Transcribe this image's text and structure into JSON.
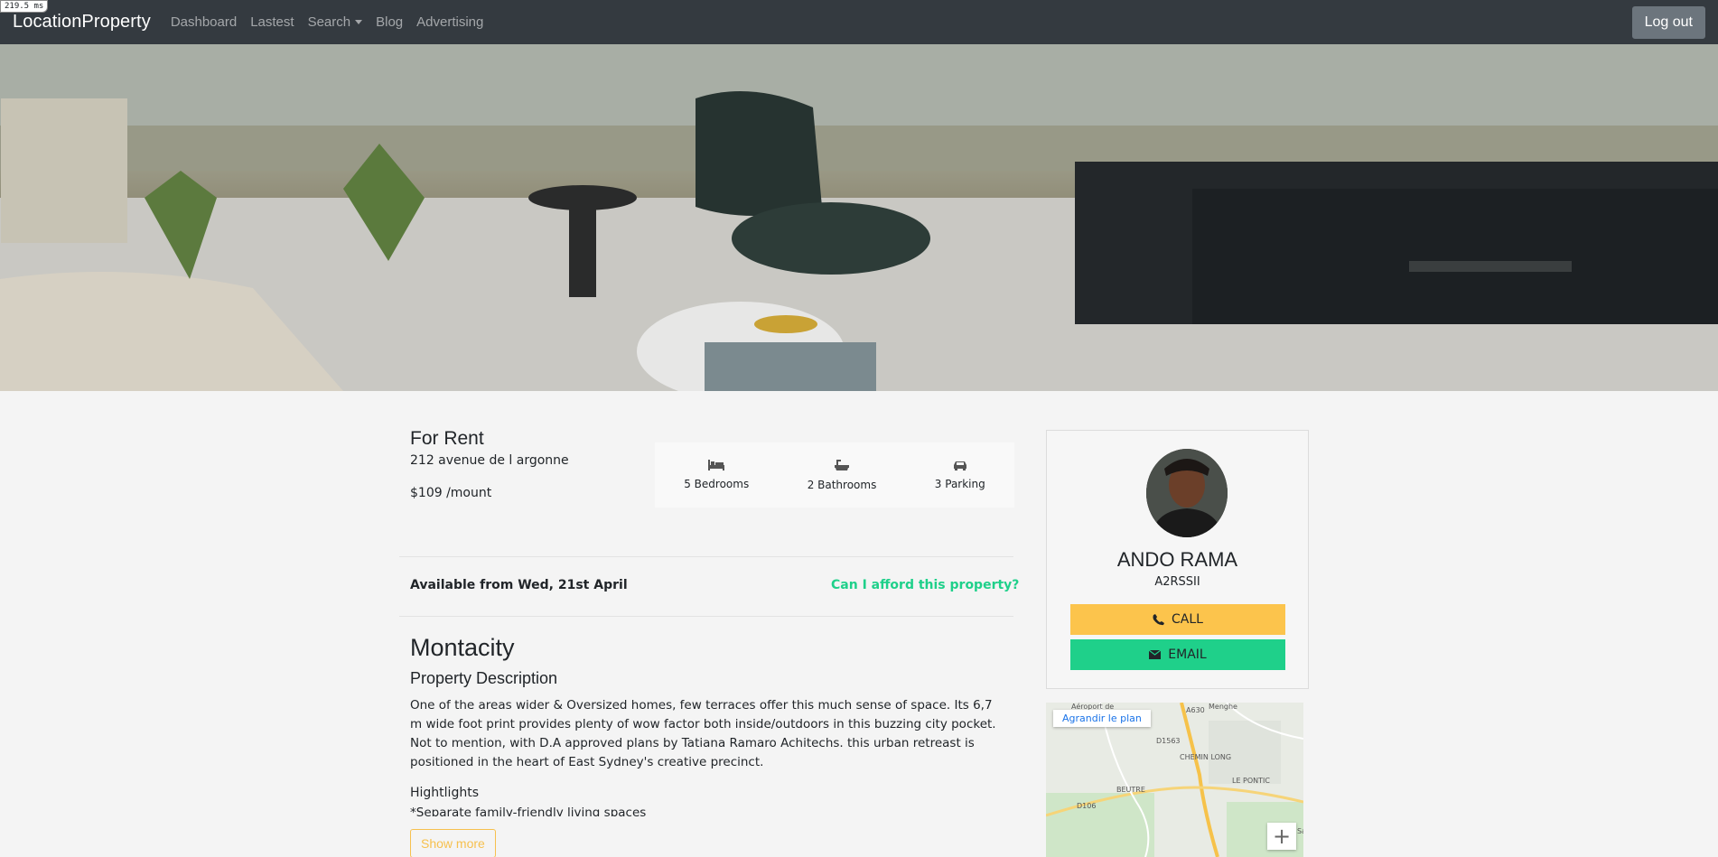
{
  "perf": "219.5 ms",
  "navbar": {
    "brand": "LocationProperty",
    "links": [
      "Dashboard",
      "Lastest",
      "Search",
      "Blog",
      "Advertising"
    ],
    "logout": "Log out"
  },
  "listing": {
    "kind": "For Rent",
    "address": "212 avenue de l argonne",
    "price": "$109 /mount",
    "features": {
      "bedrooms": "5 Bedrooms",
      "bathrooms": "2 Bathrooms",
      "parking": "3 Parking"
    },
    "available": "Available from Wed, 21st April",
    "afford_link": "Can I afford this property?",
    "name": "Montacity",
    "section_title": "Property Description",
    "description": "One of the areas wider & Oversized homes, few terraces offer this much sense of space. Its 6,7 m wide foot print provides plenty of wow factor both inside/outdoors in this buzzing city pocket. Not to mention, with D.A approved plans by Tatiana Ramaro Achitechs. this urban retreast is positioned in the heart of East Sydney's creative precinct.",
    "highlights_title": "Hightlights",
    "highlights_first": "*Separate family-friendly living spaces",
    "show_more": "Show more"
  },
  "agent": {
    "name": "ANDO RAMA",
    "code": "A2RSSII",
    "call": "CALL",
    "email": "EMAIL"
  },
  "map": {
    "enlarge": "Agrandir le plan",
    "zoom_in": "+",
    "labels": [
      "Aéroport de",
      "Menghe",
      "A630",
      "D1563",
      "CHEMIN LONG",
      "LE PONTIC",
      "BEUTRE",
      "D106",
      "Sa"
    ]
  },
  "colors": {
    "navbar": "#343a40",
    "accent_green": "#1fd08a",
    "accent_yellow": "#fcc44c"
  }
}
